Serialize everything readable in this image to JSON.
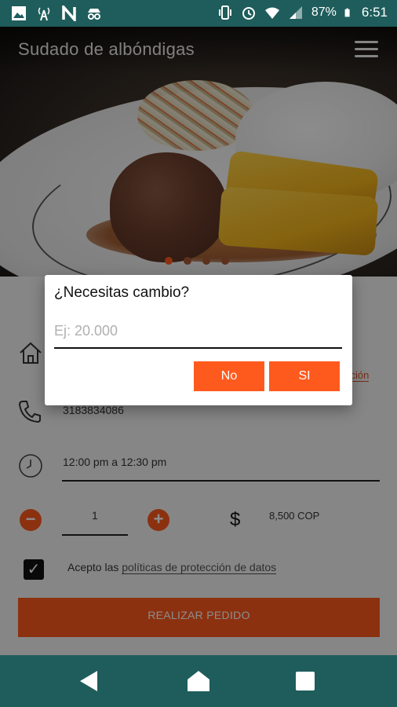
{
  "status_bar": {
    "battery": "87%",
    "time": "6:51",
    "left_icons": [
      "image-icon",
      "signal-tower-icon",
      "n-app-icon",
      "incognito-icon"
    ],
    "right_icons": [
      "vibrate-icon",
      "alarm-icon",
      "wifi-icon",
      "cell-signal-icon",
      "battery-icon"
    ]
  },
  "header": {
    "title": "Sudado de albóndigas",
    "menu_icon": "hamburger-menu-icon"
  },
  "carousel": {
    "count": 4,
    "active_index": 0
  },
  "form": {
    "address_link": "cción",
    "phone": "3183834086",
    "time_slot": "12:00 pm a 12:30 pm",
    "quantity": "1",
    "currency_symbol": "$",
    "price": "8,500 COP",
    "accept_text": "Acepto las ",
    "accept_link": "políticas de protección de datos",
    "order_button": "REALIZAR PEDIDO"
  },
  "dialog": {
    "title": "¿Necesitas cambio?",
    "input_placeholder": "Ej: 20.000",
    "no_label": "No",
    "yes_label": "SI"
  },
  "colors": {
    "primary": "#ff5a1e",
    "bars": "#1e5d5b"
  }
}
